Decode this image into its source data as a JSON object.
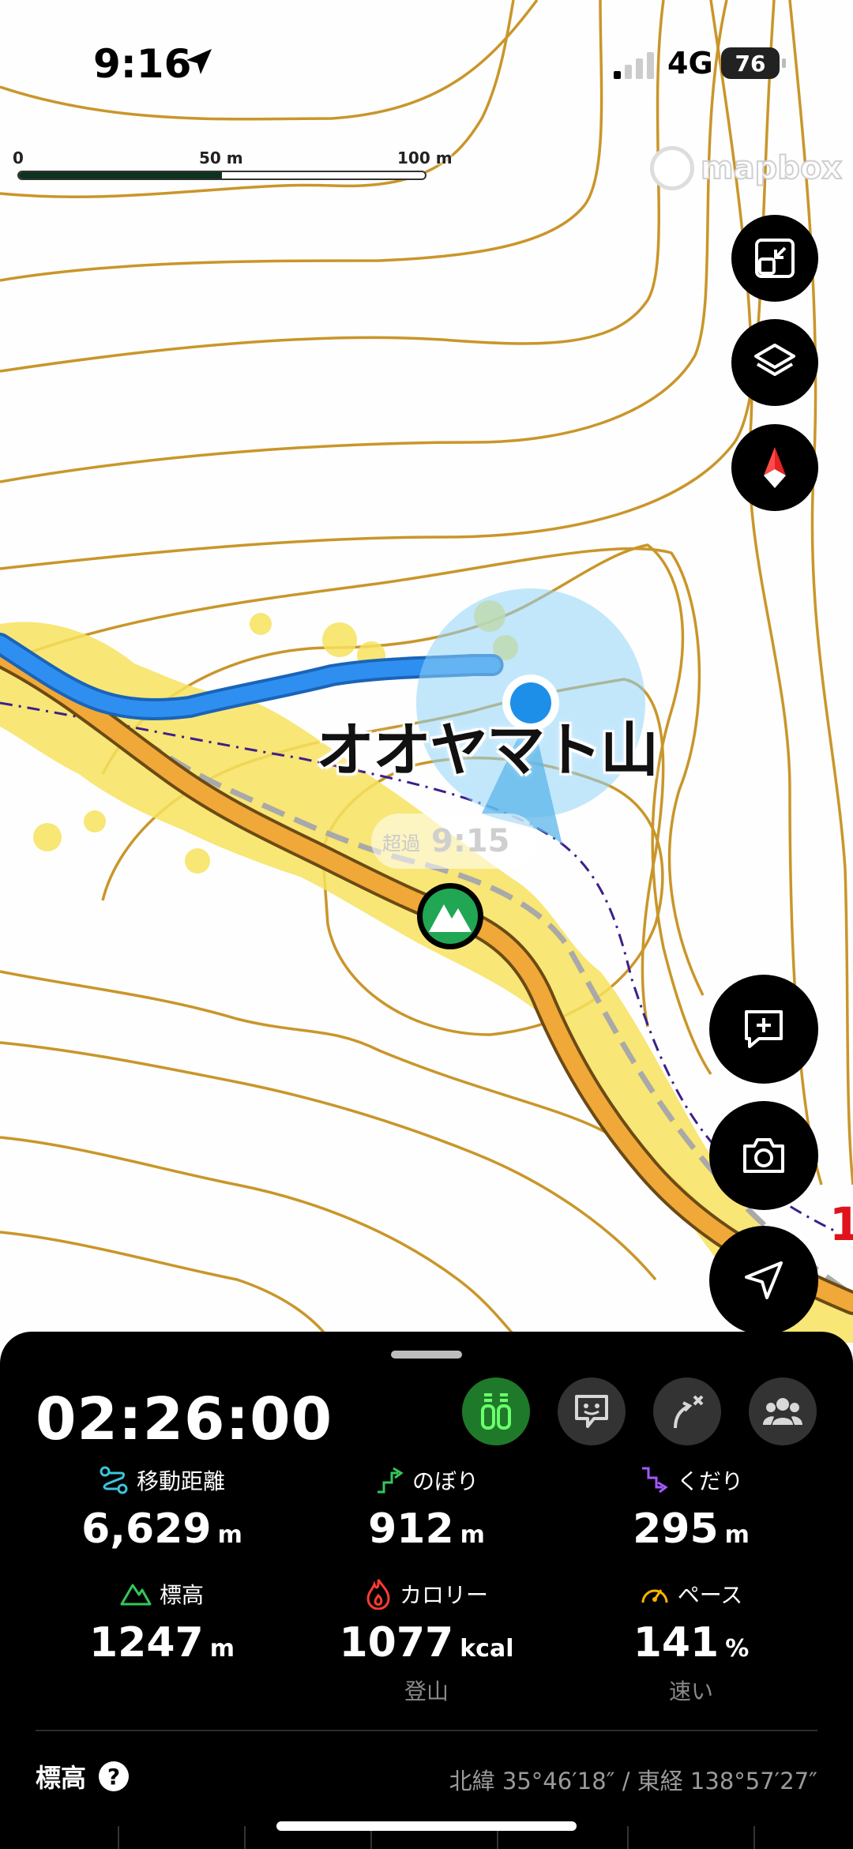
{
  "status_bar": {
    "time": "9:16",
    "network": "4G",
    "battery": "76"
  },
  "map": {
    "scale": {
      "zero": "0",
      "mid": "50 m",
      "end": "100 m"
    },
    "attribution": "mapbox",
    "peak_name": "オオヤマト山",
    "time_badge": {
      "prefix": "超過",
      "time": "9:15"
    },
    "edge_marker": "1",
    "buttons": [
      "fullscreen-exit",
      "layers",
      "compass",
      "add-note",
      "camera",
      "locate"
    ]
  },
  "panel": {
    "elapsed_time": "02:26:00",
    "modes": [
      "trail-marker-icon",
      "sticker-icon",
      "route-icon",
      "group-icon"
    ],
    "stats": [
      {
        "label": "移動距離",
        "value": "6,629",
        "unit": "m",
        "sub": "",
        "icon": "distance-icon",
        "color": "#3cc6d9"
      },
      {
        "label": "のぼり",
        "value": "912",
        "unit": "m",
        "sub": "",
        "icon": "ascent-icon",
        "color": "#34c759"
      },
      {
        "label": "くだり",
        "value": "295",
        "unit": "m",
        "sub": "",
        "icon": "descent-icon",
        "color": "#a259ff"
      },
      {
        "label": "標高",
        "value": "1247",
        "unit": "m",
        "sub": "",
        "icon": "altitude-icon",
        "color": "#34c759"
      },
      {
        "label": "カロリー",
        "value": "1077",
        "unit": "kcal",
        "sub": "登山",
        "icon": "calorie-icon",
        "color": "#ff3b30"
      },
      {
        "label": "ペース",
        "value": "141",
        "unit": "%",
        "sub": "速い",
        "icon": "pace-icon",
        "color": "#ffb300"
      }
    ],
    "elevation_label": "標高",
    "help": "?",
    "coordinates": "北緯 35°46′18″ / 東経 138°57′27″"
  }
}
